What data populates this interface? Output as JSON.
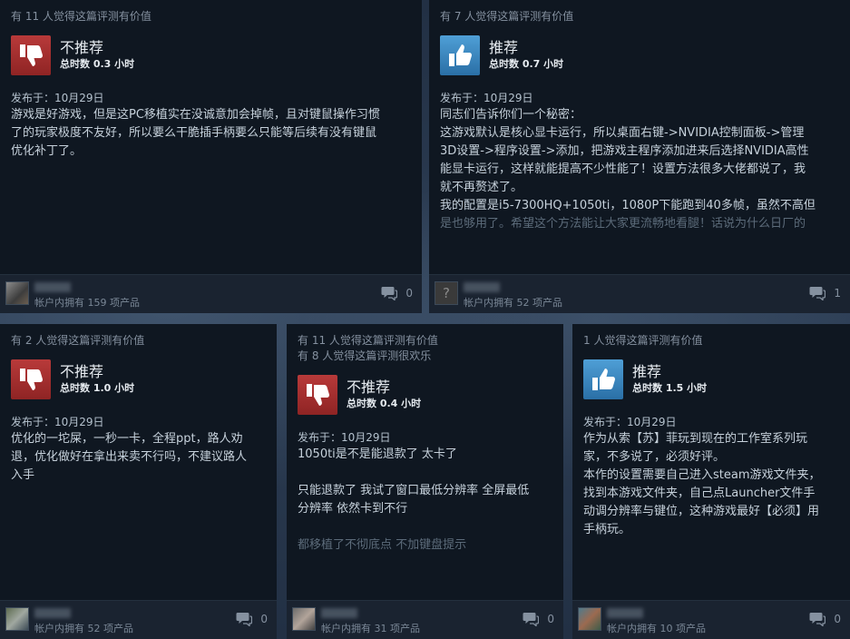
{
  "reviews": [
    {
      "helpful": [
        "有 11 人觉得这篇评测有价值"
      ],
      "verdict": "不推荐",
      "recommended": false,
      "hours": "总时数 0.3 小时",
      "posted": "发布于：10月29日",
      "body": [
        "游戏是好游戏，但是这PC移植实在没诚意加会掉帧，且对键鼠操作习惯",
        "了的玩家极度不友好，所以要么干脆插手柄要么只能等后续有没有键鼠",
        "优化补丁了。"
      ],
      "faded": [],
      "owns": "帐户内拥有 159 项产品",
      "comments": "0"
    },
    {
      "helpful": [
        "有 7 人觉得这篇评测有价值"
      ],
      "verdict": "推荐",
      "recommended": true,
      "hours": "总时数 0.7 小时",
      "posted": "发布于：10月29日",
      "body": [
        "同志们告诉你们一个秘密：",
        "这游戏默认是核心显卡运行，所以桌面右键->NVIDIA控制面板->管理",
        "3D设置->程序设置->添加，把游戏主程序添加进来后选择NVIDIA高性",
        "能显卡运行，这样就能提高不少性能了！设置方法很多大佬都说了，我",
        "就不再赘述了。",
        "我的配置是i5-7300HQ+1050ti，1080P下能跑到40多帧，虽然不高但",
        "是也够用了。希望这个方法能让大家更流畅地看腿！话说为什么日厂的"
      ],
      "faded": [],
      "owns": "帐户内拥有 52 项产品",
      "comments": "1"
    },
    {
      "helpful": [
        "有 2 人觉得这篇评测有价值"
      ],
      "verdict": "不推荐",
      "recommended": false,
      "hours": "总时数 1.0 小时",
      "posted": "发布于：10月29日",
      "body": [
        "优化的一坨屎，一秒一卡，全程ppt，路人劝",
        "退，优化做好在拿出来卖不行吗，不建议路人",
        "入手"
      ],
      "faded": [],
      "owns": "帐户内拥有 52 项产品",
      "comments": "0"
    },
    {
      "helpful": [
        "有 11 人觉得这篇评测有价值",
        "有 8 人觉得这篇评测很欢乐"
      ],
      "verdict": "不推荐",
      "recommended": false,
      "hours": "总时数 0.4 小时",
      "posted": "发布于：10月29日",
      "body": [
        "1050ti是不是能退款了 太卡了",
        "",
        "只能退款了 我试了窗口最低分辨率 全屏最低",
        "分辨率 依然卡到不行"
      ],
      "faded": [
        "",
        "都移植了不彻底点 不加键盘提示"
      ],
      "owns": "帐户内拥有 31 项产品",
      "comments": "0"
    },
    {
      "helpful": [
        "1 人觉得这篇评测有价值"
      ],
      "verdict": "推荐",
      "recommended": true,
      "hours": "总时数 1.5 小时",
      "posted": "发布于：10月29日",
      "body": [
        "作为从索【苏】菲玩到现在的工作室系列玩",
        "家，不多说了，必须好评。",
        "本作的设置需要自己进入steam游戏文件夹，",
        "找到本游戏文件夹，自己点Launcher文件手",
        "动调分辨率与键位，这种游戏最好【必须】用",
        "手柄玩。"
      ],
      "faded": [],
      "owns": "帐户内拥有 10 项产品",
      "comments": "0"
    }
  ],
  "avatar_placeholder": "?",
  "icons": {
    "thumbs_down": "thumbs-down-icon",
    "thumbs_up": "thumbs-up-icon",
    "comment": "comment-icon"
  }
}
